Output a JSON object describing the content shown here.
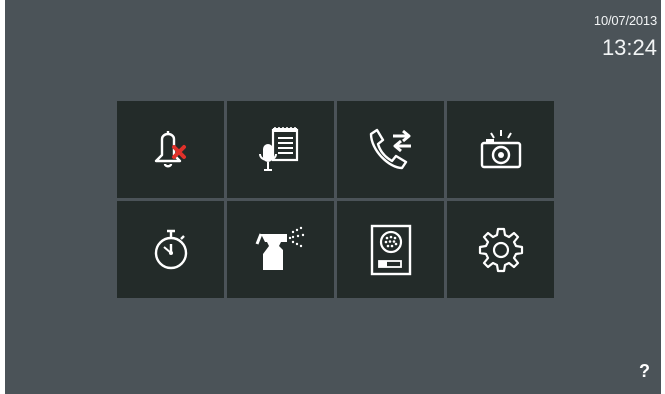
{
  "status": {
    "date": "10/07/2013",
    "time": "13:24"
  },
  "tiles": [
    {
      "icon": "bell-muted-icon",
      "row": 1,
      "col": 1
    },
    {
      "icon": "voice-memo-notepad-icon",
      "row": 1,
      "col": 2
    },
    {
      "icon": "call-transfer-icon",
      "row": 1,
      "col": 3
    },
    {
      "icon": "camera-icon",
      "row": 1,
      "col": 4
    },
    {
      "icon": "stopwatch-icon",
      "row": 2,
      "col": 1
    },
    {
      "icon": "spray-bottle-icon",
      "row": 2,
      "col": 2
    },
    {
      "icon": "door-panel-icon",
      "row": 2,
      "col": 3
    },
    {
      "icon": "gear-icon",
      "row": 2,
      "col": 4
    }
  ],
  "help": {
    "label": "?"
  },
  "colors": {
    "background": "#4b5358",
    "tile": "#232b29",
    "icon": "#ffffff",
    "mute_x": "#e0312a"
  }
}
